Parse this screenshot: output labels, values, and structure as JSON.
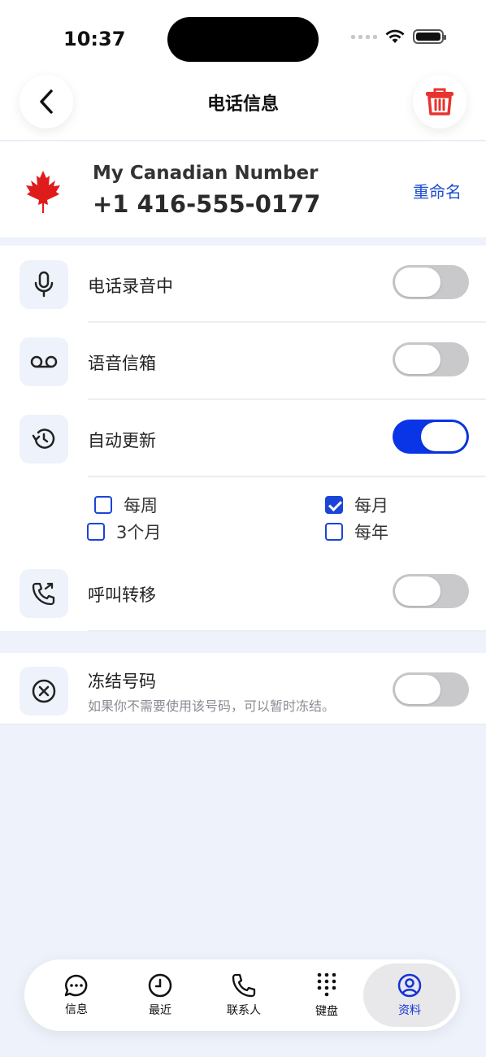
{
  "status_bar": {
    "time": "10:37"
  },
  "header": {
    "title": "电话信息"
  },
  "number": {
    "name": "My Canadian Number",
    "phone": "+1 416-555-0177",
    "rename_label": "重命名",
    "flag_icon": "canada-flag-icon"
  },
  "settings": {
    "recording": {
      "label": "电话录音中",
      "on": false,
      "icon": "microphone-icon"
    },
    "voicemail": {
      "label": "语音信箱",
      "on": false,
      "icon": "voicemail-icon"
    },
    "auto_renew": {
      "label": "自动更新",
      "on": true,
      "icon": "history-icon"
    },
    "renew_options": [
      {
        "label": "每周",
        "checked": false
      },
      {
        "label": "每月",
        "checked": true
      },
      {
        "label": "3个月",
        "checked": false
      },
      {
        "label": "每年",
        "checked": false
      }
    ],
    "call_forward": {
      "label": "呼叫转移",
      "on": false,
      "icon": "call-forward-icon"
    }
  },
  "freeze": {
    "label": "冻结号码",
    "subtitle": "如果你不需要使用该号码，可以暂时冻结。",
    "on": false,
    "icon": "close-circle-icon"
  },
  "tabbar": {
    "items": [
      {
        "label": "信息",
        "icon": "message-icon"
      },
      {
        "label": "最近",
        "icon": "clock-icon"
      },
      {
        "label": "联系人",
        "icon": "phone-icon"
      },
      {
        "label": "键盘",
        "icon": "keypad-icon"
      },
      {
        "label": "资料",
        "icon": "profile-icon",
        "active": true
      }
    ]
  },
  "colors": {
    "accent": "#0a35e6",
    "danger": "#e8332f",
    "background": "#eef3fb"
  }
}
